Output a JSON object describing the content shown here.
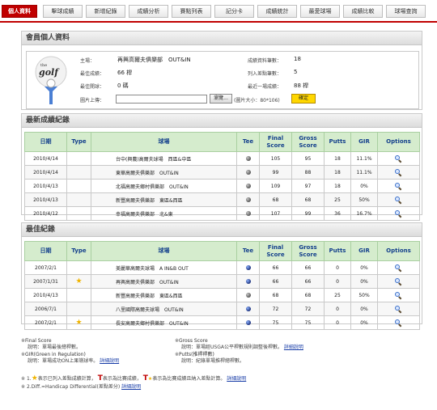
{
  "tabs": [
    {
      "label": "個人資料",
      "active": true
    },
    {
      "label": "擊球成績",
      "active": false
    },
    {
      "label": "新增紀錄",
      "active": false
    },
    {
      "label": "成績分析",
      "active": false
    },
    {
      "label": "賽點列表",
      "active": false
    },
    {
      "label": "記分卡",
      "active": false
    },
    {
      "label": "成績統計",
      "active": false
    },
    {
      "label": "最愛球場",
      "active": false
    },
    {
      "label": "成績比較",
      "active": false
    },
    {
      "label": "球場查詢",
      "active": false
    }
  ],
  "profile": {
    "heading": "會員個人資料",
    "logo_text": "golf",
    "logo_small": "the",
    "home_course_label": "主場：",
    "home_course": "再興高爾夫俱樂部　OUT&IN",
    "best_score_label": "最佳成績：",
    "best_score": "66 桿",
    "best_hole_label": "最佳開球：",
    "best_hole": "0 碼",
    "upload_label": "圖片上傳：",
    "browse_label": "瀏覽...",
    "upload_hint": "(圖片大小：80*106)",
    "confirm_label": "確定",
    "records_label": "成績資料筆數：",
    "records": "18",
    "diff_label": "列入差點筆數：",
    "diff_count": "5",
    "last_label": "最近一場成績：",
    "last_score": "88 桿"
  },
  "recent": {
    "heading": "最新成績紀錄",
    "columns": [
      "日期",
      "Type",
      "球場",
      "Tee",
      "Final Score",
      "Gross Score",
      "Putts",
      "GIR",
      "Options"
    ],
    "rows": [
      {
        "date": "2010/4/14",
        "type": "",
        "course": "台中(興農)高爾夫球場　西區&中區",
        "tee": "gray",
        "final": "105",
        "gross": "95",
        "putts": "18",
        "gir": "11.1%"
      },
      {
        "date": "2010/4/14",
        "type": "",
        "course": "東華高爾夫俱樂部　OUT&IN",
        "tee": "gray",
        "final": "99",
        "gross": "88",
        "putts": "18",
        "gir": "11.1%"
      },
      {
        "date": "2010/4/13",
        "type": "",
        "course": "北福高爾夫鄉村俱樂部　OUT&IN",
        "tee": "gray",
        "final": "109",
        "gross": "97",
        "putts": "18",
        "gir": "0%"
      },
      {
        "date": "2010/4/13",
        "type": "",
        "course": "新豐高爾夫俱樂部　東區&西區",
        "tee": "gray",
        "final": "68",
        "gross": "68",
        "putts": "25",
        "gir": "50%"
      },
      {
        "date": "2010/4/12",
        "type": "",
        "course": "幸福高爾夫俱樂部　北&東",
        "tee": "gray",
        "final": "107",
        "gross": "99",
        "putts": "36",
        "gir": "16.7%"
      }
    ]
  },
  "best": {
    "heading": "最佳紀錄",
    "columns": [
      "日期",
      "Type",
      "球場",
      "Tee",
      "Final Score",
      "Gross Score",
      "Putts",
      "GIR",
      "Options"
    ],
    "rows": [
      {
        "date": "2007/2/1",
        "type": "",
        "course": "美麗華高爾夫球場　A IN&B OUT",
        "tee": "blue",
        "final": "66",
        "gross": "66",
        "putts": "0",
        "gir": "0%"
      },
      {
        "date": "2007/1/31",
        "type": "star",
        "course": "再興高爾夫俱樂部　OUT&IN",
        "tee": "blue",
        "final": "66",
        "gross": "66",
        "putts": "0",
        "gir": "0%"
      },
      {
        "date": "2010/4/13",
        "type": "",
        "course": "新豐高爾夫俱樂部　東區&西區",
        "tee": "gray",
        "final": "68",
        "gross": "68",
        "putts": "25",
        "gir": "50%"
      },
      {
        "date": "2006/7/1",
        "type": "",
        "course": "八里國際高爾夫球場　OUT&IN",
        "tee": "blue",
        "final": "72",
        "gross": "72",
        "putts": "0",
        "gir": "0%"
      },
      {
        "date": "2007/2/1",
        "type": "star",
        "course": "長安高爾夫鄉村俱樂部　OUT&IN",
        "tee": "blue",
        "final": "75",
        "gross": "75",
        "putts": "0",
        "gir": "0%"
      }
    ]
  },
  "notes": {
    "final_title": "Final Score",
    "final_desc": "說明：單場最後總桿數。",
    "gross_title": "Gross Score",
    "gross_desc": "說明：單場經USGA公平桿數規則調整後桿數。",
    "gross_link": "詳細說明",
    "gir_title": "GIR(Green in Regulation)",
    "gir_desc": "說明：單場成功ON上果嶺球率。",
    "gir_link": "詳細說明",
    "putts_title": "Putts(推桿桿數)",
    "putts_desc": "說明：紀錄單場推桿總桿數。",
    "legend_1a": "1.",
    "legend_1b": "表示已列入差點成績計算，",
    "legend_1c": "表示為比賽成績，",
    "legend_1d": "表示為比賽成績且納入差點計算。",
    "legend_link": "詳細說明",
    "legend_2": "2.Diff.=Handicap Differential(差點差分)",
    "legend_2_link": "詳細說明"
  }
}
